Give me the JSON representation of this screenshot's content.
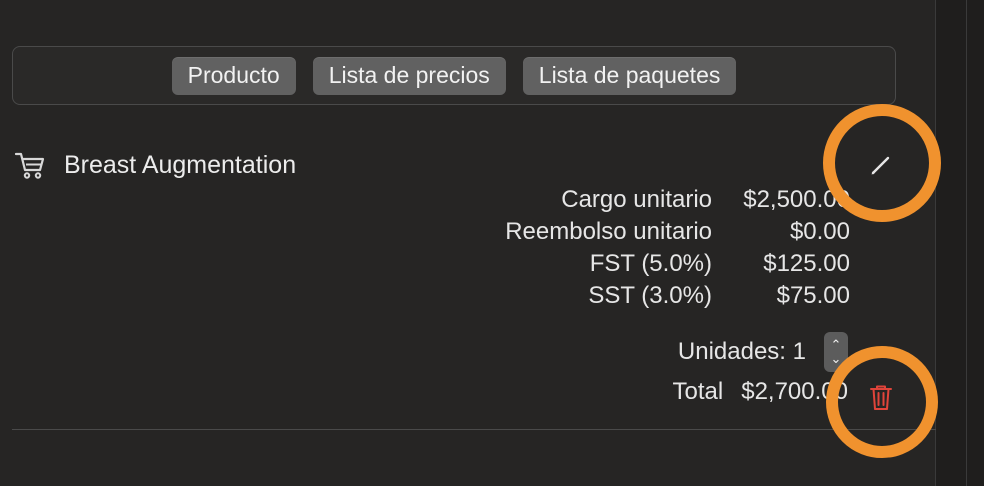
{
  "segments": [
    "Producto",
    "Lista de precios",
    "Lista de paquetes"
  ],
  "product": {
    "icon": "cart-icon",
    "name": "Breast Augmentation"
  },
  "details": [
    {
      "label": "Cargo unitario",
      "value": "$2,500.00"
    },
    {
      "label": "Reembolso unitario",
      "value": "$0.00"
    },
    {
      "label": "FST (5.0%)",
      "value": "$125.00"
    },
    {
      "label": "SST (3.0%)",
      "value": "$75.00"
    }
  ],
  "units": {
    "label": "Unidades: 1"
  },
  "total": {
    "label": "Total",
    "value": "$2,700.00"
  },
  "colors": {
    "annotation": "#f0922e",
    "trash": "#e0443a",
    "segment_bg": "#616161",
    "background": "#262524"
  }
}
